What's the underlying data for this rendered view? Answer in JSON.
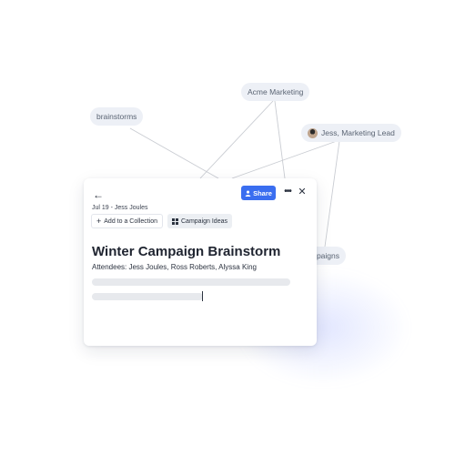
{
  "tags": {
    "acme": "Acme Marketing",
    "brainstorms": "brainstorms",
    "jess": "Jess, Marketing Lead",
    "campaigns": "Campaigns"
  },
  "card": {
    "share_label": "Share",
    "more_glyph": "•••",
    "close_glyph": "✕",
    "back_glyph": "←",
    "meta": "Jul 19 - Jess Joules",
    "add_collection_label": "Add to a Collection",
    "add_plus": "+",
    "campaign_tag_label": "Campaign Ideas",
    "title": "Winter Campaign Brainstorm",
    "attendees": "Attendees: Jess Joules, Ross Roberts, Alyssa King"
  },
  "colors": {
    "accent": "#3a6ef0",
    "chip_bg": "#edf0f6",
    "line": "#c9ccd2"
  },
  "icons": {
    "back": "arrow-left-icon",
    "share": "person-icon",
    "more": "more-horizontal-icon",
    "close": "close-icon",
    "collection": "grid-icon"
  }
}
